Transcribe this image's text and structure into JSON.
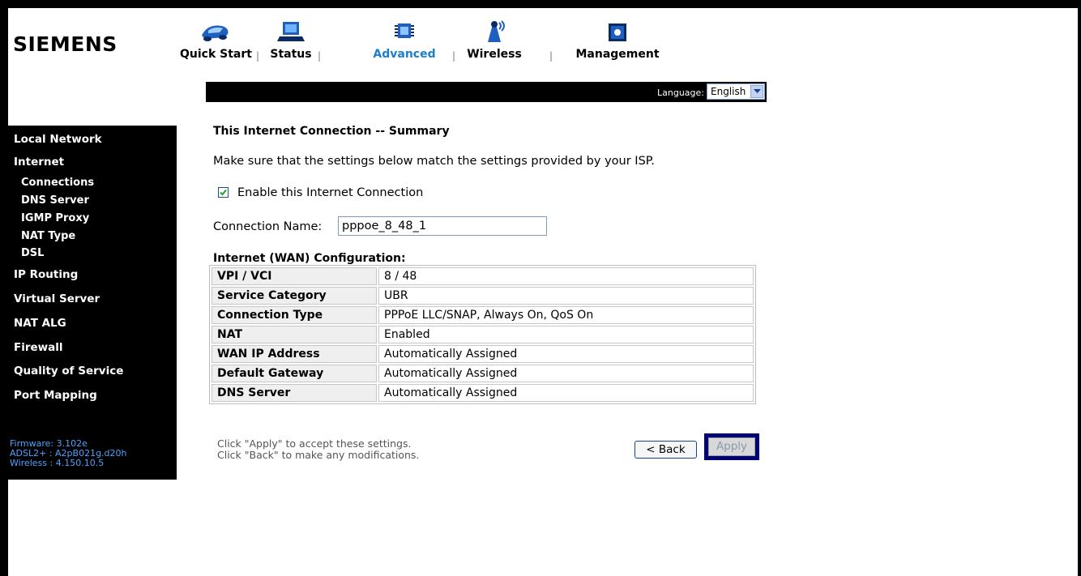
{
  "brand": {
    "logo": "SIEMENS"
  },
  "topnav": {
    "items": [
      {
        "label": "Quick Start",
        "icon": "car-icon"
      },
      {
        "label": "Status",
        "icon": "laptop-icon"
      },
      {
        "label": "Advanced",
        "icon": "chip-icon",
        "active": true
      },
      {
        "label": "Wireless",
        "icon": "antenna-icon"
      },
      {
        "label": "Management",
        "icon": "gear-box-icon"
      }
    ],
    "separator": "|"
  },
  "language": {
    "label": "Language:",
    "selected": "English"
  },
  "sidebar": {
    "items": [
      {
        "label": "Local Network"
      },
      {
        "label": "Internet"
      },
      {
        "label": "Connections"
      },
      {
        "label": "DNS Server"
      },
      {
        "label": "IGMP Proxy"
      },
      {
        "label": "NAT Type"
      },
      {
        "label": "DSL"
      },
      {
        "label": "IP Routing"
      },
      {
        "label": "Virtual Server"
      },
      {
        "label": "NAT ALG"
      },
      {
        "label": "Firewall"
      },
      {
        "label": "Quality of Service"
      },
      {
        "label": "Port Mapping"
      }
    ],
    "firmware": [
      "Firmware: 3.102e",
      "ADSL2+ :  A2pB021g.d20h",
      "Wireless : 4.150.10.5"
    ]
  },
  "main": {
    "title": "This Internet Connection -- Summary",
    "instruction": "Make sure that the settings below match the settings provided by your ISP.",
    "enable_label": "Enable this Internet Connection",
    "enable_checked": true,
    "conn_name_label": "Connection Name:",
    "conn_name_value": "pppoe_8_48_1",
    "wan_header": "Internet (WAN) Configuration:",
    "rows": [
      {
        "key": "VPI / VCI",
        "value": "8 / 48"
      },
      {
        "key": "Service Category",
        "value": "UBR"
      },
      {
        "key": "Connection Type",
        "value": "PPPoE LLC/SNAP, Always On, QoS On"
      },
      {
        "key": "NAT",
        "value": "Enabled"
      },
      {
        "key": "WAN IP Address",
        "value": "Automatically Assigned"
      },
      {
        "key": "Default Gateway",
        "value": "Automatically Assigned"
      },
      {
        "key": "DNS Server",
        "value": "Automatically Assigned"
      }
    ],
    "help_line1": "Click \"Apply\" to accept these settings.",
    "help_line2": "Click \"Back\" to make any modifications.",
    "back_label": "< Back",
    "apply_label": "Apply"
  },
  "colors": {
    "active_nav": "#1a7fd0",
    "sidebar_bg": "#000000",
    "firmware_text": "#4da3ff",
    "apply_focus": "#000077"
  }
}
